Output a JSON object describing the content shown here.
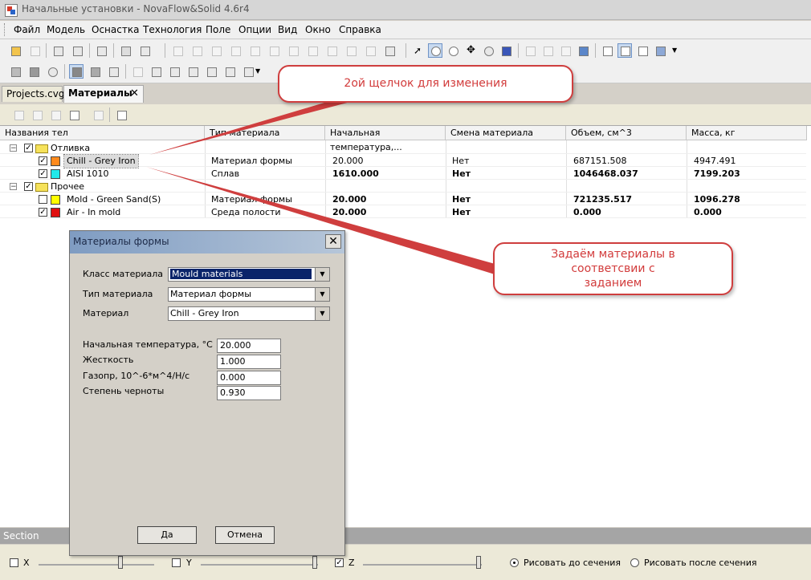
{
  "window": {
    "title": "Начальные установки - NovaFlow&Solid 4.6r4"
  },
  "menu": [
    "Файл",
    "Модель",
    "Оснастка",
    "Технология",
    "Поле",
    "Опции",
    "Вид",
    "Окно",
    "Справка"
  ],
  "tabs": [
    {
      "label": "Projects.cvg"
    },
    {
      "label": "Материалы"
    }
  ],
  "table": {
    "headers": [
      "Названия тел",
      "Тип материала",
      "Начальная температура,...",
      "Смена материала",
      "Объем, см^3",
      "Масса, кг"
    ],
    "groups": [
      {
        "name": "Отливка",
        "rows": [
          {
            "name": "Chill - Grey Iron",
            "swatch": "#ff8a1c",
            "type": "Материал формы",
            "temp": "20.000",
            "change": "Нет",
            "volume": "687151.508",
            "mass": "4947.491"
          },
          {
            "name": "AISI 1010",
            "swatch": "#21e8ea",
            "type": "Сплав",
            "temp": "1610.000",
            "change": "Нет",
            "volume": "1046468.037",
            "mass": "7199.203"
          }
        ]
      },
      {
        "name": "Прочее",
        "rows": [
          {
            "name": "Mold - Green Sand(S)",
            "swatch": "#ffff00",
            "type": "Материал формы",
            "temp": "20.000",
            "change": "Нет",
            "volume": "721235.517",
            "mass": "1096.278"
          },
          {
            "name": "Air - In mold",
            "swatch": "#e01010",
            "type": "Среда полости",
            "temp": "20.000",
            "change": "Нет",
            "volume": "0.000",
            "mass": "0.000"
          }
        ]
      }
    ]
  },
  "dialog": {
    "title": "Материалы формы",
    "material_class_label": "Класс материала",
    "material_class_value": "Mould materials",
    "material_type_label": "Тип материала",
    "material_type_value": "Материал формы",
    "material_label": "Материал",
    "material_value": "Chill - Grey Iron",
    "init_temp_label": "Начальная температура, °C",
    "init_temp_value": "20.000",
    "stiffness_label": "Жесткость",
    "stiffness_value": "1.000",
    "gas_perm_label": "Газопр, 10^-6*м^4/Н/с",
    "gas_perm_value": "0.000",
    "emissivity_label": "Степень черноты",
    "emissivity_value": "0.930",
    "ok_label": "Да",
    "cancel_label": "Отмена"
  },
  "section": {
    "title": "Section",
    "x_label": "X",
    "y_label": "Y",
    "z_label": "Z",
    "draw_before_label": "Рисовать до сечения",
    "draw_after_label": "Рисовать после сечения",
    "x_checked": false,
    "y_checked": false,
    "z_checked": true,
    "draw_before_selected": true
  },
  "callouts": {
    "top_text": "2ой щелчок для изменения",
    "right_text": "Задаём материалы в соответсвии с заданием",
    "color": "#cf3e3e"
  }
}
